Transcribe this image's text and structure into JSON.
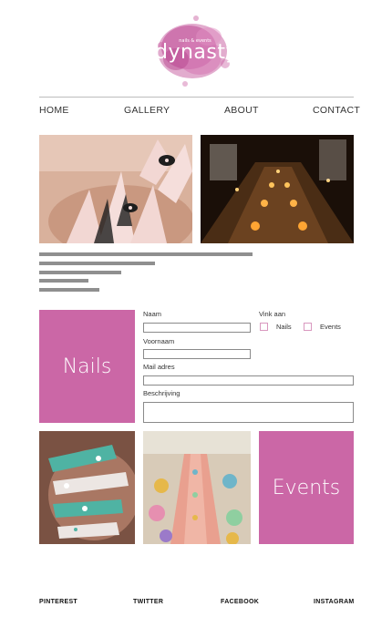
{
  "logo": {
    "tagline": "nails & events",
    "wordmark": "dynasty",
    "color": "#cb67a6"
  },
  "nav": {
    "home": "HOME",
    "gallery": "GALLERY",
    "about": "ABOUT",
    "contact": "CONTACT"
  },
  "boxes": {
    "nails": "Nails",
    "events": "Events",
    "color": "#cb67a6"
  },
  "form": {
    "naam_label": "Naam",
    "voornaam_label": "Voornaam",
    "mail_label": "Mail  adres",
    "beschrijving_label": "Beschrijving",
    "vink_label": "Vink aan",
    "option_nails": "Nails",
    "option_events": "Events"
  },
  "footer": {
    "pinterest": "PINTEREST",
    "twitter": "TWITTER",
    "facebook": "FACEBOOK",
    "instagram": "INSTAGRAM"
  }
}
